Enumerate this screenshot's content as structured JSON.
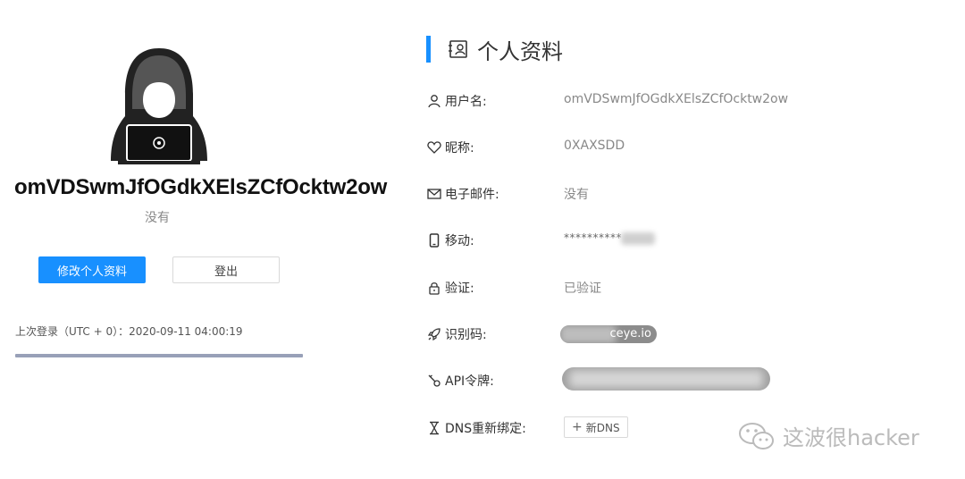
{
  "profile": {
    "username": "omVDSwmJfOGdkXElsZCfOcktw2ow",
    "email": "没有",
    "edit_button": "修改个人资料",
    "logout_button": "登出",
    "last_login": "上次登录（UTC + 0）：2020-09-11 04:00:19",
    "progress_fraction": 1.0
  },
  "details": {
    "title": "个人资料",
    "rows": [
      {
        "label": "用户名:",
        "value": "omVDSwmJfOGdkXElsZCfOcktw2ow",
        "icon": "user-icon"
      },
      {
        "label": "昵称:",
        "value": "0XAXSDD",
        "icon": "heart-icon"
      },
      {
        "label": "电子邮件:",
        "value": "没有",
        "icon": "mail-icon"
      },
      {
        "label": "移动:",
        "value": "**********",
        "icon": "mobile-icon"
      },
      {
        "label": "验证:",
        "value": "已验证",
        "icon": "lock-icon"
      },
      {
        "label": "识别码:",
        "value": "ceye.io",
        "icon": "rocket-icon"
      },
      {
        "label": "API令牌:",
        "value": "",
        "icon": "key-icon"
      },
      {
        "label": "DNS重新绑定:",
        "value": "",
        "icon": "hourglass-icon"
      }
    ],
    "add_dns_button": "新DNS"
  },
  "watermark": "这波很hacker",
  "colors": {
    "accent": "#1890ff",
    "progress": "#98a0b8"
  }
}
